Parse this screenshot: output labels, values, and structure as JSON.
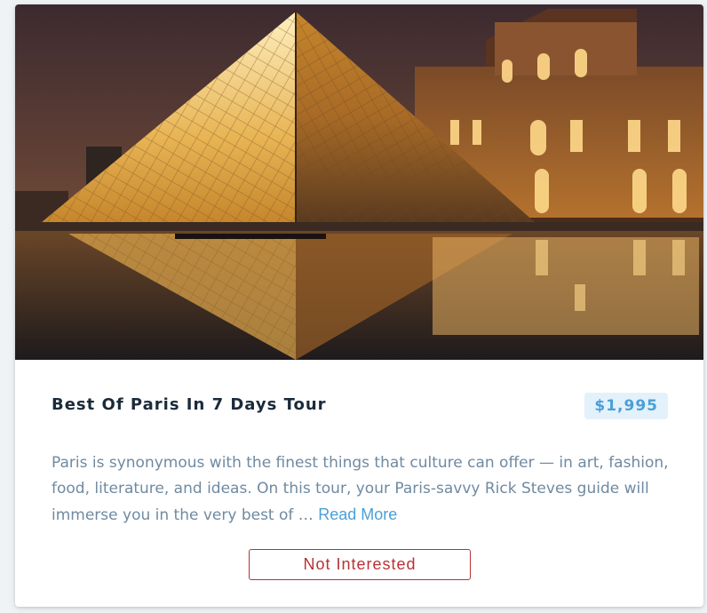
{
  "tour": {
    "title": "Best Of Paris In 7 Days Tour",
    "price": "$1,995",
    "description": "Paris is synonymous with the finest things that culture can offer — in art, fashion, food, literature, and ideas. On this tour, your Paris-savvy Rick Steves guide will immerse you in the very best of … ",
    "read_more_label": "Read More",
    "not_interested_label": "Not Interested"
  },
  "colors": {
    "accent": "#4a9fd8",
    "price_bg": "#e3f1fb",
    "danger": "#b83234",
    "title_text": "#1b2a3a",
    "body_text": "#6f8aa1"
  }
}
